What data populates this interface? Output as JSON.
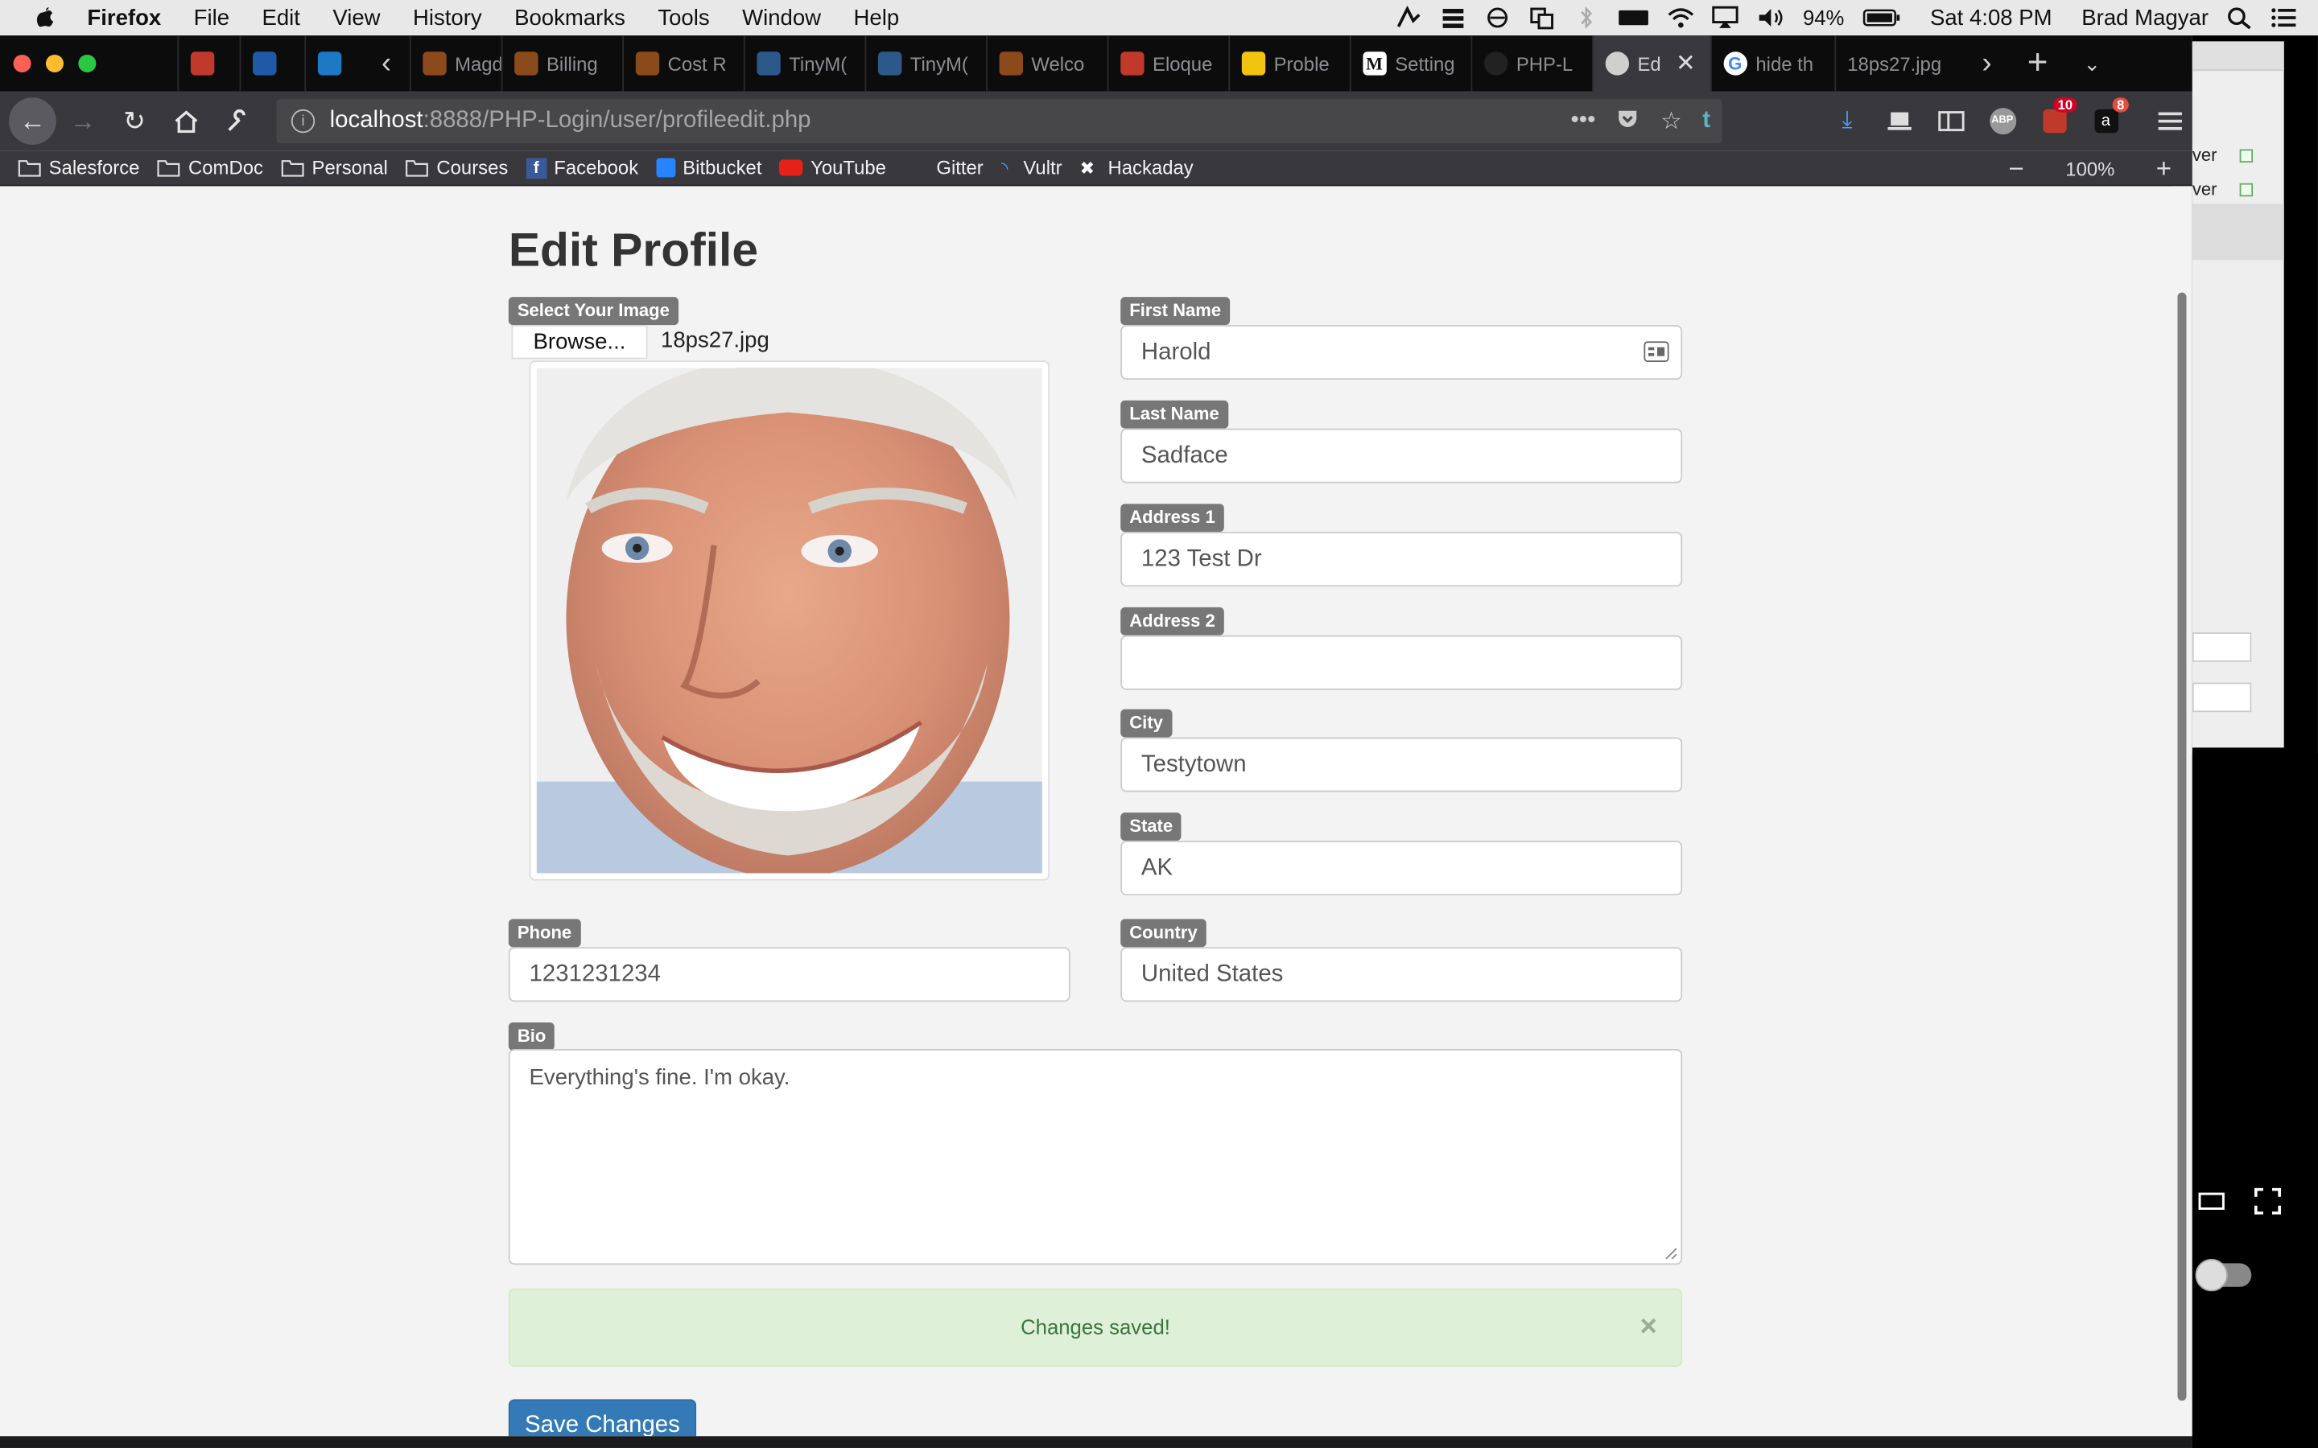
{
  "menubar": {
    "app": "Firefox",
    "items": [
      "File",
      "Edit",
      "View",
      "History",
      "Bookmarks",
      "Tools",
      "Window",
      "Help"
    ],
    "battery": "94%",
    "clock": "Sat 4:08 PM",
    "user": "Brad Magyar"
  },
  "tabs": [
    {
      "label": "",
      "color": "#c0392b"
    },
    {
      "label": "",
      "color": "#1e5aa8"
    },
    {
      "label": "",
      "color": "#1d78c6"
    },
    {
      "label": "Magde",
      "color": "#8a4a1a"
    },
    {
      "label": "Billing",
      "color": "#8a4a1a"
    },
    {
      "label": "Cost R",
      "color": "#8a4a1a"
    },
    {
      "label": "TinyM(",
      "color": "#2b5a8a"
    },
    {
      "label": "TinyM(",
      "color": "#2b5a8a"
    },
    {
      "label": "Welco",
      "color": "#8a4a1a"
    },
    {
      "label": "Eloque",
      "color": "#c0392b"
    },
    {
      "label": "Proble",
      "color": "#f1c40f"
    },
    {
      "label": "Setting",
      "color": "#111111"
    },
    {
      "label": "PHP-L",
      "color": "#222222"
    },
    {
      "label": "Ed",
      "color": "#cfcfcf"
    },
    {
      "label": "hide th",
      "color": "#4285f4"
    },
    {
      "label": "18ps27.jpg",
      "color": ""
    }
  ],
  "url": {
    "host": "localhost",
    "path": ":8888/PHP-Login/user/profileedit.php"
  },
  "toolbar_badges": {
    "first": "10",
    "second": "8"
  },
  "bookmarks": [
    "Salesforce",
    "ComDoc",
    "Personal",
    "Courses",
    "Facebook",
    "Bitbucket",
    "YouTube",
    "Gitter",
    "Vultr",
    "Hackaday"
  ],
  "zoom": "100%",
  "page": {
    "title": "Edit Profile",
    "image": {
      "label": "Select Your Image",
      "browse": "Browse...",
      "filename": "18ps27.jpg"
    },
    "fields": {
      "first_name": {
        "label": "First Name",
        "value": "Harold"
      },
      "last_name": {
        "label": "Last Name",
        "value": "Sadface"
      },
      "address1": {
        "label": "Address 1",
        "value": "123 Test Dr"
      },
      "address2": {
        "label": "Address 2",
        "value": ""
      },
      "city": {
        "label": "City",
        "value": "Testytown"
      },
      "state": {
        "label": "State",
        "value": "AK"
      },
      "phone": {
        "label": "Phone",
        "value": "1231231234"
      },
      "country": {
        "label": "Country",
        "value": "United States"
      },
      "bio": {
        "label": "Bio",
        "value": "Everything's fine. I'm okay."
      }
    },
    "alert": "Changes saved!",
    "alert_close": "×",
    "save_button": "Save Changes"
  },
  "background_window": {
    "text1": "ver",
    "text2": "ver"
  }
}
